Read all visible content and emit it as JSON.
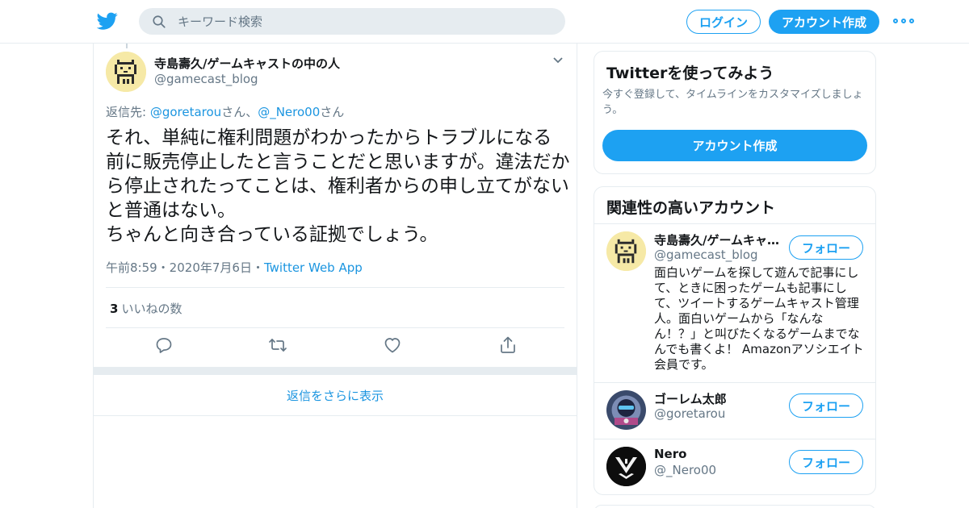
{
  "header": {
    "search_placeholder": "キーワード検索",
    "login_label": "ログイン",
    "signup_label": "アカウント作成"
  },
  "tweet": {
    "author_name": "寺島壽久/ゲームキャストの中の人",
    "author_handle": "@gamecast_blog",
    "reply_prefix": "返信先: ",
    "reply_mention_1": "@goretarou",
    "reply_suffix_1": "さん、",
    "reply_mention_2": "@_Nero00",
    "reply_suffix_2": "さん",
    "text": "それ、単純に権利問題がわかったからトラブルになる前に販売停止したと言うことだと思いますが。違法だから停止されたってことは、権利者からの申し立てがないと普通はない。\nちゃんと向き合っている証拠でしょう。",
    "timestamp": "午前8:59・2020年7月6日・",
    "source": "Twitter Web App",
    "likes_count": "3",
    "likes_label": "いいねの数",
    "more_replies_label": "返信をさらに表示"
  },
  "sidebar": {
    "promo_title": "Twitterを使ってみよう",
    "promo_desc": "今すぐ登録して、タイムラインをカスタマイズしましょう。",
    "promo_button": "アカウント作成",
    "related_title": "関連性の高いアカウント",
    "follow_label": "フォロー",
    "accounts": [
      {
        "name": "寺島壽久/ゲームキャ…",
        "handle": "@gamecast_blog",
        "bio": "面白いゲームを探して遊んで記事にして、ときに困ったゲームも記事にして、ツイートするゲームキャスト管理人。面白いゲームから「なんなん！？」と叫びたくなるゲームまでなんでも書くよ！ Amazonアソシエイト会員です。"
      },
      {
        "name": "ゴーレム太郎",
        "handle": "@goretarou",
        "bio": ""
      },
      {
        "name": "Nero",
        "handle": "@_Nero00",
        "bio": ""
      }
    ]
  },
  "colors": {
    "accent": "#1da1f2",
    "link": "#1b95e0",
    "secondary_text": "#657786",
    "border": "#e6ecf0"
  },
  "icons": [
    "twitter-logo-icon",
    "search-icon",
    "more-icon",
    "chevron-down-icon",
    "reply-icon",
    "retweet-icon",
    "like-icon",
    "share-icon"
  ]
}
